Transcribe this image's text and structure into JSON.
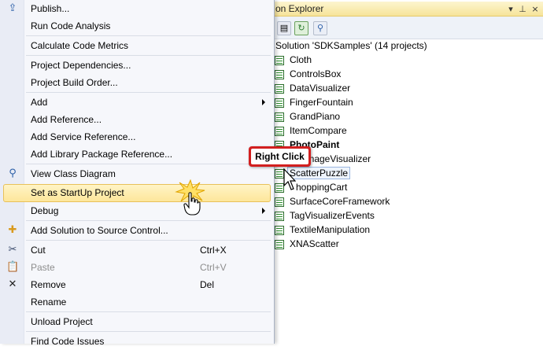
{
  "solution_explorer": {
    "title": "on Explorer",
    "root": "Solution 'SDKSamples' (14 projects)",
    "projects": [
      "Cloth",
      "ControlsBox",
      "DataVisualizer",
      "FingerFountain",
      "GrandPiano",
      "ItemCompare",
      "PhotoPaint",
      "ShoppingImageVisualizer",
      "ScatterPuzzle",
      "ShoppingCart",
      "SurfaceCoreFramework",
      "TagVisualizerEvents",
      "TextileManipulation",
      "XNAScatter"
    ],
    "projects_display": [
      "Cloth",
      "ControlsBox",
      "DataVisualizer",
      "FingerFountain",
      "GrandPiano",
      "ItemCompare",
      "PhotoPaint",
      "ImageVisualizer",
      "ScatterPuzzle",
      "hoppingCart",
      "SurfaceCoreFramework",
      "TagVisualizerEvents",
      "TextileManipulation",
      "XNAScatter"
    ]
  },
  "context_menu": {
    "items": [
      {
        "label": "Publish...",
        "icon": "publish-icon"
      },
      {
        "label": "Run Code Analysis"
      },
      {
        "label": "Calculate Code Metrics"
      },
      {
        "label": "Project Dependencies..."
      },
      {
        "label": "Project Build Order..."
      },
      {
        "label": "Add",
        "submenu": true
      },
      {
        "label": "Add Reference..."
      },
      {
        "label": "Add Service Reference..."
      },
      {
        "label": "Add Library Package Reference..."
      },
      {
        "label": "View Class Diagram",
        "icon": "class-diagram-icon"
      },
      {
        "label": "Set as StartUp Project",
        "highlighted": true
      },
      {
        "label": "Debug",
        "submenu": true
      },
      {
        "label": "Add Solution to Source Control...",
        "icon": "source-control-icon"
      },
      {
        "label": "Cut",
        "shortcut": "Ctrl+X",
        "icon": "cut-icon"
      },
      {
        "label": "Paste",
        "shortcut": "Ctrl+V",
        "disabled": true,
        "icon": "paste-icon"
      },
      {
        "label": "Remove",
        "shortcut": "Del",
        "icon": "remove-icon"
      },
      {
        "label": "Rename"
      },
      {
        "label": "Unload Project"
      },
      {
        "label": "Find Code Issues"
      }
    ]
  },
  "annotation": {
    "callout_text": "Right Click"
  },
  "colors": {
    "menu_highlight": "#fde69b",
    "callout_border": "#d21f1f",
    "tab_gold": "#f6e49a"
  }
}
